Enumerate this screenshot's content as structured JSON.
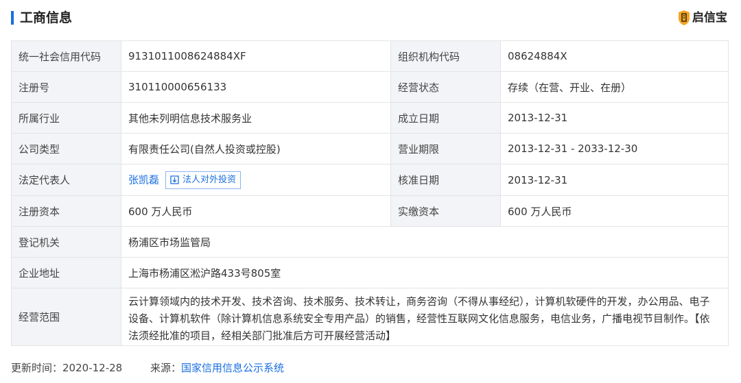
{
  "header": {
    "title": "工商信息",
    "brand": "启信宝"
  },
  "rows": {
    "credit_code_label": "统一社会信用代码",
    "credit_code": "9131011008624884XF",
    "org_code_label": "组织机构代码",
    "org_code": "08624884X",
    "reg_no_label": "注册号",
    "reg_no": "310110000656133",
    "status_label": "经营状态",
    "status": "存续（在营、开业、在册）",
    "industry_label": "所属行业",
    "industry": "其他未列明信息技术服务业",
    "founded_label": "成立日期",
    "founded": "2013-12-31",
    "type_label": "公司类型",
    "type": "有限责任公司(自然人投资或控股)",
    "term_label": "营业期限",
    "term": "2013-12-31 - 2033-12-30",
    "legal_rep_label": "法定代表人",
    "legal_rep": "张凯磊",
    "legal_rep_btn": "法人对外投资",
    "approval_label": "核准日期",
    "approval": "2013-12-31",
    "capital_label": "注册资本",
    "capital": "600 万人民币",
    "paid_label": "实缴资本",
    "paid": "600 万人民币",
    "authority_label": "登记机关",
    "authority": "杨浦区市场监管局",
    "address_label": "企业地址",
    "address": "上海市杨浦区淞沪路433号805室",
    "scope_label": "经营范围",
    "scope": "云计算领域内的技术开发、技术咨询、技术服务、技术转让，商务咨询（不得从事经纪），计算机软硬件的开发，办公用品、电子设备、计算机软件（除计算机信息系统安全专用产品）的销售，经营性互联网文化信息服务，电信业务，广播电视节目制作。【依法须经批准的项目，经相关部门批准后方可开展经营活动】"
  },
  "footer": {
    "updated_label": "更新时间：",
    "updated": "2020-12-28",
    "source_label": "来源：",
    "source": "国家信用信息公示系统"
  },
  "colors": {
    "accent": "#1a6fe0",
    "label_bg": "#f2f4f7",
    "brand_orange": "#f5a623"
  }
}
